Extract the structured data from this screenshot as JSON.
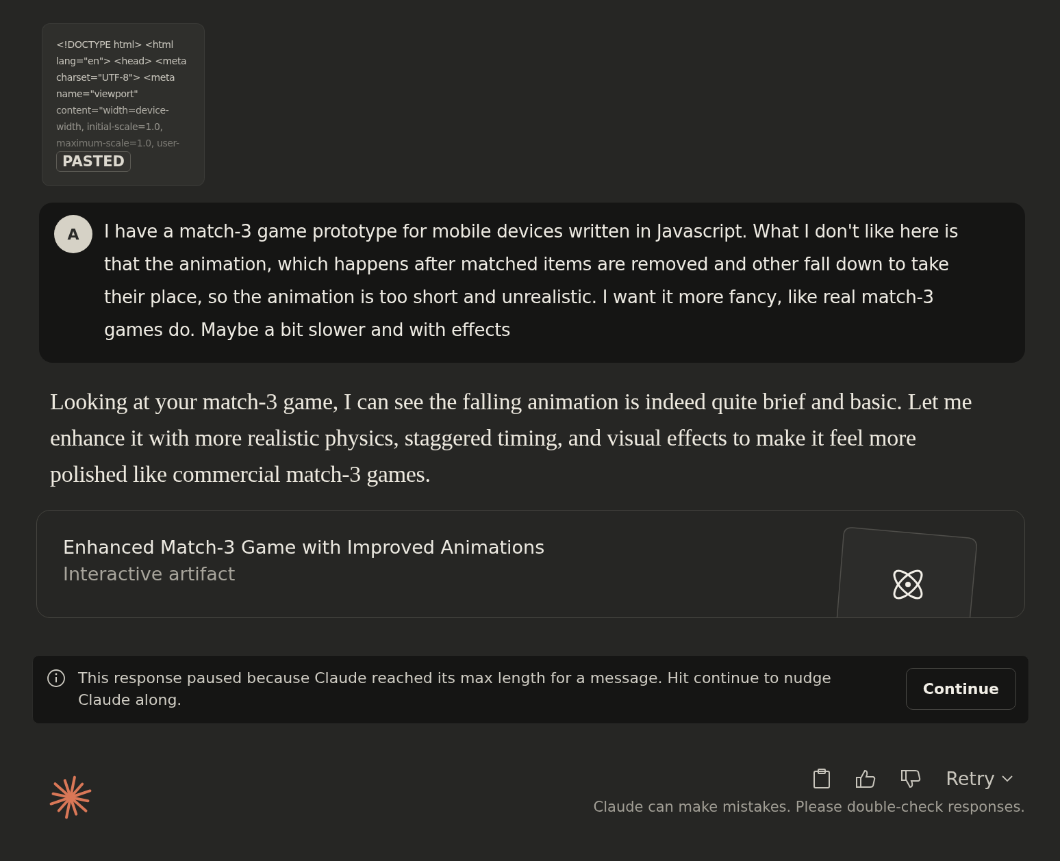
{
  "pasted": {
    "lines": [
      "<!DOCTYPE html> <html",
      "lang=\"en\"> <head> <meta",
      "charset=\"UTF-8\"> <meta",
      "name=\"viewport\"",
      "content=\"width=device-",
      "width, initial-scale=1.0,",
      "maximum-scale=1.0, user-"
    ],
    "badge": "PASTED"
  },
  "user_message": {
    "avatar": "A",
    "text": "I have a match-3 game prototype for mobile devices written in Javascript. What I don't like here is that the animation, which happens after matched items are removed and other fall down to take their place, so the animation is too short and unrealistic. I want it more fancy, like real match-3 games do. Maybe a bit slower and with effects"
  },
  "response": {
    "text": "Looking at your match-3 game, I can see the falling animation is indeed quite brief and basic. Let me enhance it with more realistic physics, staggered timing, and visual effects to make it feel more polished like commercial match-3 games."
  },
  "artifact": {
    "title": "Enhanced Match-3 Game with Improved Animations",
    "subtitle": "Interactive artifact"
  },
  "notice": {
    "text": "This response paused because Claude reached its max length for a message. Hit continue to nudge Claude along.",
    "button": "Continue"
  },
  "actions": {
    "retry": "Retry"
  },
  "footer": "Claude can make mistakes. Please double-check responses."
}
